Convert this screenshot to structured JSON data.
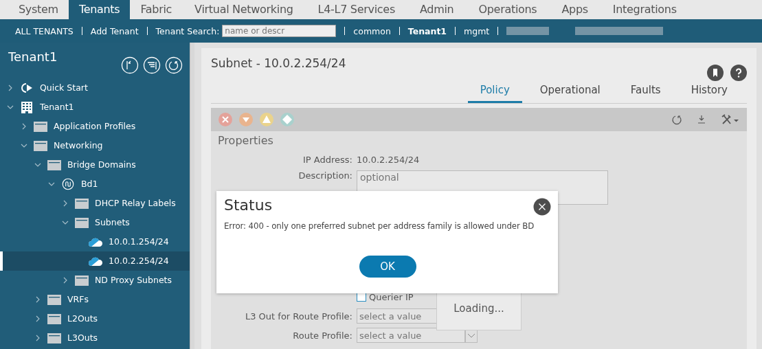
{
  "top_tabs": [
    {
      "label": "System",
      "selected": false
    },
    {
      "label": "Tenants",
      "selected": true
    },
    {
      "label": "Fabric",
      "selected": false
    },
    {
      "label": "Virtual Networking",
      "selected": false
    },
    {
      "label": "L4-L7 Services",
      "selected": false
    },
    {
      "label": "Admin",
      "selected": false
    },
    {
      "label": "Operations",
      "selected": false
    },
    {
      "label": "Apps",
      "selected": false
    },
    {
      "label": "Integrations",
      "selected": false
    }
  ],
  "sub_nav": {
    "all_tenants": "ALL TENANTS",
    "add_tenant": "Add Tenant",
    "search_label": "Tenant Search:",
    "search_placeholder": "name or descr",
    "tenants": [
      {
        "label": "common",
        "selected": false
      },
      {
        "label": "Tenant1",
        "selected": true
      },
      {
        "label": "mgmt",
        "selected": false
      }
    ]
  },
  "sidebar": {
    "title": "Tenant1",
    "tree": [
      {
        "label": "Quick Start",
        "kind": "quickstart",
        "expanded": false,
        "selected": false
      },
      {
        "label": "Tenant1",
        "kind": "tenant",
        "expanded": true,
        "selected": false,
        "children": [
          {
            "label": "Application Profiles",
            "kind": "folder",
            "expanded": false,
            "selected": false
          },
          {
            "label": "Networking",
            "kind": "folder",
            "expanded": true,
            "selected": false,
            "children": [
              {
                "label": "Bridge Domains",
                "kind": "folder",
                "expanded": true,
                "selected": false,
                "children": [
                  {
                    "label": "Bd1",
                    "kind": "bridge-domain",
                    "expanded": true,
                    "selected": false,
                    "children": [
                      {
                        "label": "DHCP Relay Labels",
                        "kind": "folder",
                        "expanded": false,
                        "selected": false
                      },
                      {
                        "label": "Subnets",
                        "kind": "folder",
                        "expanded": true,
                        "selected": false,
                        "children": [
                          {
                            "label": "10.0.1.254/24",
                            "kind": "subnet",
                            "selected": false
                          },
                          {
                            "label": "10.0.2.254/24",
                            "kind": "subnet",
                            "selected": true
                          }
                        ]
                      },
                      {
                        "label": "ND Proxy Subnets",
                        "kind": "folder",
                        "expanded": false,
                        "selected": false
                      }
                    ]
                  }
                ]
              },
              {
                "label": "VRFs",
                "kind": "folder",
                "expanded": false,
                "selected": false
              },
              {
                "label": "L2Outs",
                "kind": "folder",
                "expanded": false,
                "selected": false
              },
              {
                "label": "L3Outs",
                "kind": "folder",
                "expanded": false,
                "selected": false
              }
            ]
          }
        ]
      }
    ]
  },
  "panel": {
    "title": "Subnet - 10.0.2.254/24",
    "tabs": [
      {
        "label": "Policy",
        "selected": true
      },
      {
        "label": "Operational",
        "selected": false
      },
      {
        "label": "Faults",
        "selected": false
      },
      {
        "label": "History",
        "selected": false
      }
    ],
    "section": "Properties",
    "ip_address": {
      "label": "IP Address:",
      "value": "10.0.2.254/24"
    },
    "description": {
      "label": "Description:",
      "placeholder": "optional"
    },
    "querier_ip": {
      "label": "Querier IP",
      "checked": false
    },
    "l3out": {
      "label": "L3 Out for Route Profile:",
      "placeholder": "select a value"
    },
    "route_profile": {
      "label": "Route Profile:",
      "placeholder": "select a value"
    },
    "loading": "Loading..."
  },
  "dialog": {
    "title": "Status",
    "message": "Error: 400 - only one preferred subnet per address family is allowed under BD",
    "ok": "OK"
  }
}
